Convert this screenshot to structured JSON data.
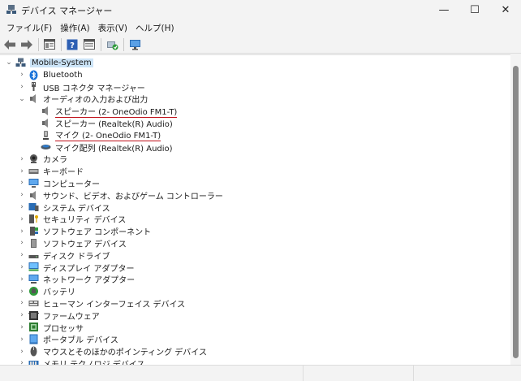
{
  "window": {
    "title": "デバイス マネージャー",
    "minimize": "—",
    "maximize": "☐",
    "close": "✕"
  },
  "menu": [
    "ファイル(F)",
    "操作(A)",
    "表示(V)",
    "ヘルプ(H)"
  ],
  "toolbar": {
    "icons": [
      "back-icon",
      "forward-icon",
      "properties-icon",
      "help-icon",
      "show-hidden-icon",
      "update-driver-icon",
      "scan-hardware-icon"
    ]
  },
  "tree": {
    "root": "Mobile-System",
    "items": [
      {
        "label": "Bluetooth",
        "icon": "bluetooth-icon",
        "level": 1,
        "expanded": false
      },
      {
        "label": "USB コネクタ マネージャー",
        "icon": "usb-icon",
        "level": 1,
        "expanded": false
      },
      {
        "label": "オーディオの入力および出力",
        "icon": "speaker-icon",
        "level": 1,
        "expanded": true
      },
      {
        "label": "スピーカー (2- OneOdio FM1-T)",
        "icon": "speaker-icon",
        "level": 2,
        "underline": true
      },
      {
        "label": "スピーカー (Realtek(R) Audio)",
        "icon": "speaker-icon",
        "level": 2
      },
      {
        "label": "マイク (2- OneOdio FM1-T)",
        "icon": "microphone-icon",
        "level": 2,
        "underline": true
      },
      {
        "label": "マイク配列 (Realtek(R) Audio)",
        "icon": "mic-array-icon",
        "level": 2
      },
      {
        "label": "カメラ",
        "icon": "camera-icon",
        "level": 1,
        "expanded": false
      },
      {
        "label": "キーボード",
        "icon": "keyboard-icon",
        "level": 1,
        "expanded": false
      },
      {
        "label": "コンピューター",
        "icon": "computer-icon",
        "level": 1,
        "expanded": false
      },
      {
        "label": "サウンド、ビデオ、およびゲーム コントローラー",
        "icon": "sound-icon",
        "level": 1,
        "expanded": false
      },
      {
        "label": "システム デバイス",
        "icon": "system-device-icon",
        "level": 1,
        "expanded": false
      },
      {
        "label": "セキュリティ デバイス",
        "icon": "security-icon",
        "level": 1,
        "expanded": false
      },
      {
        "label": "ソフトウェア コンポーネント",
        "icon": "software-component-icon",
        "level": 1,
        "expanded": false
      },
      {
        "label": "ソフトウェア デバイス",
        "icon": "software-device-icon",
        "level": 1,
        "expanded": false
      },
      {
        "label": "ディスク ドライブ",
        "icon": "disk-icon",
        "level": 1,
        "expanded": false
      },
      {
        "label": "ディスプレイ アダプター",
        "icon": "display-icon",
        "level": 1,
        "expanded": false
      },
      {
        "label": "ネットワーク アダプター",
        "icon": "network-icon",
        "level": 1,
        "expanded": false
      },
      {
        "label": "バッテリ",
        "icon": "battery-icon",
        "level": 1,
        "expanded": false
      },
      {
        "label": "ヒューマン インターフェイス デバイス",
        "icon": "hid-icon",
        "level": 1,
        "expanded": false
      },
      {
        "label": "ファームウェア",
        "icon": "firmware-icon",
        "level": 1,
        "expanded": false
      },
      {
        "label": "プロセッサ",
        "icon": "processor-icon",
        "level": 1,
        "expanded": false
      },
      {
        "label": "ポータブル デバイス",
        "icon": "portable-icon",
        "level": 1,
        "expanded": false
      },
      {
        "label": "マウスとそのほかのポインティング デバイス",
        "icon": "mouse-icon",
        "level": 1,
        "expanded": false
      },
      {
        "label": "メモリ テクノロジ デバイス",
        "icon": "memory-icon",
        "level": 1,
        "expanded": false
      }
    ]
  },
  "colors": {
    "selection": "#cce4f7",
    "underline": "#c0101a",
    "scrollbar": "#8a8a8a"
  }
}
